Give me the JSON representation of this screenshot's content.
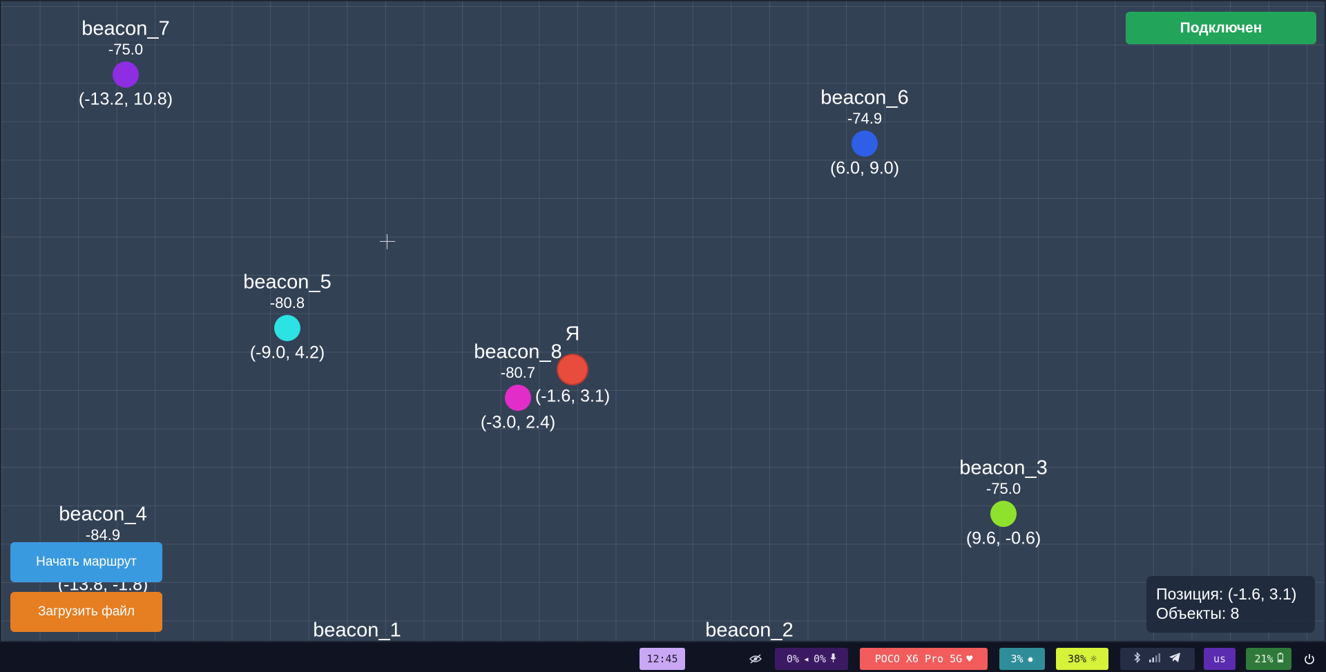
{
  "status_button": "Подключен",
  "me": {
    "label": "Я",
    "coords": "(-1.6, 3.1)",
    "color": "#e74c3c"
  },
  "beacons": [
    {
      "name": "beacon_7",
      "rssi": "-75.0",
      "coords": "(-13.2, 10.8)",
      "color": "#8e2de2"
    },
    {
      "name": "beacon_6",
      "rssi": "-74.9",
      "coords": "(6.0, 9.0)",
      "color": "#2f5fe6"
    },
    {
      "name": "beacon_5",
      "rssi": "-80.8",
      "coords": "(-9.0, 4.2)",
      "color": "#2de2e2"
    },
    {
      "name": "beacon_8",
      "rssi": "-80.7",
      "coords": "(-3.0, 2.4)",
      "color": "#e22dc8"
    },
    {
      "name": "beacon_3",
      "rssi": "-75.0",
      "coords": "(9.6, -0.6)",
      "color": "#8ee22d"
    },
    {
      "name": "beacon_4",
      "rssi": "-84.9",
      "coords": "(-13.8, -1.8)",
      "color": "#e2a72d"
    },
    {
      "name": "beacon_1",
      "rssi": "",
      "coords": "",
      "color": "#e2a72d"
    },
    {
      "name": "beacon_2",
      "rssi": "",
      "coords": "",
      "color": "#e2a72d"
    }
  ],
  "buttons": {
    "start_route": "Начать маршрут",
    "load_file": "Загрузить файл"
  },
  "info": {
    "position": "Позиция: (-1.6, 3.1)",
    "objects": "Объекты: 8"
  },
  "taskbar": {
    "clock": "12:45",
    "audio_out": "0%",
    "audio_in": "0%",
    "device": "POCO X6 Pro 5G",
    "cpu": "3%",
    "brightness": "38%",
    "layout": "us",
    "battery": "21%",
    "icons": [
      "eye-off-icon",
      "speaker-icon",
      "microphone-icon",
      "heart-icon",
      "cpu-icon",
      "brightness-icon",
      "bluetooth-icon",
      "signal-icon",
      "telegram-icon",
      "battery-icon",
      "power-icon"
    ]
  }
}
